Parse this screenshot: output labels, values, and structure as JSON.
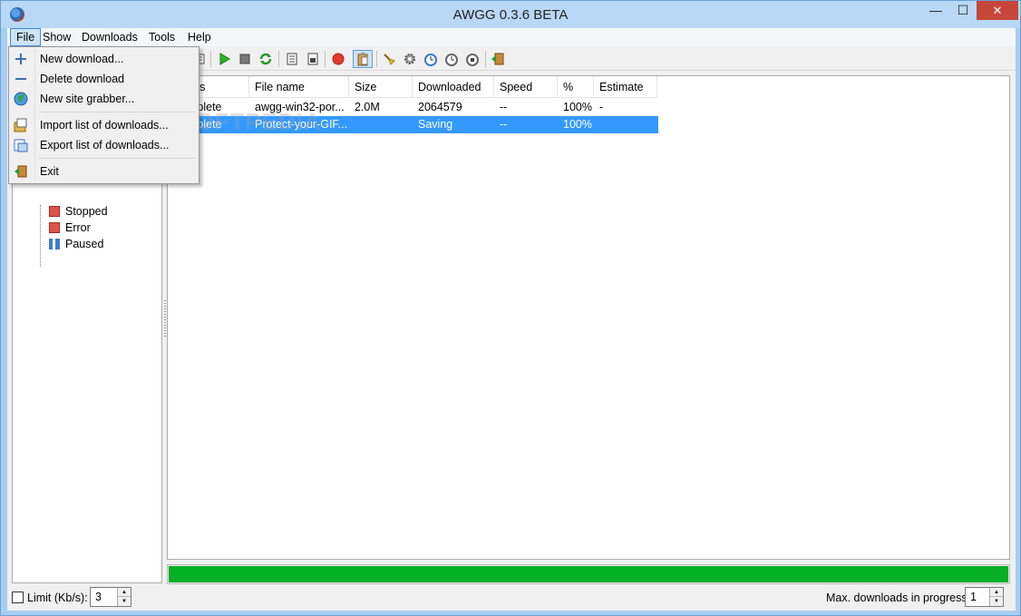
{
  "window": {
    "title": "AWGG 0.3.6 BETA",
    "minimize": "—",
    "maximize": "☐",
    "close": "✕"
  },
  "menubar": {
    "items": [
      "File",
      "Show",
      "Downloads",
      "Tools",
      "Help"
    ]
  },
  "file_menu": {
    "items": [
      {
        "label": "New download...",
        "icon": "plus-icon"
      },
      {
        "label": "Delete download",
        "icon": "minus-icon"
      },
      {
        "label": "New site grabber...",
        "icon": "globe-icon"
      },
      {
        "label": "Import list of downloads...",
        "icon": "import-icon"
      },
      {
        "label": "Export list of downloads...",
        "icon": "export-icon"
      },
      {
        "label": "Exit",
        "icon": "exit-icon"
      }
    ]
  },
  "toolbar": {
    "buttons": [
      "list-icon",
      "start-icon",
      "stop-icon",
      "restart-icon",
      "queue-icon",
      "queue-up-icon",
      "record-icon",
      "clipboard-icon",
      "clean-icon",
      "settings-icon",
      "scheduler-start-icon",
      "scheduler-clock-icon",
      "scheduler-stop-icon",
      "exit-icon"
    ]
  },
  "tree": {
    "items": [
      {
        "label": "Stopped",
        "color": "#e0524a"
      },
      {
        "label": "Error",
        "color": "#e0524a"
      },
      {
        "label": "Paused",
        "color": "#3d7bd0"
      }
    ]
  },
  "downloads": {
    "columns": [
      "Status",
      "File name",
      "Size",
      "Downloaded",
      "Speed",
      "%",
      "Estimate"
    ],
    "rows": [
      {
        "status": "Complete",
        "file_name": "awgg-win32-por...",
        "size": "2.0M",
        "downloaded": "2064579",
        "speed": "--",
        "percent": "100%",
        "estimate": "-"
      },
      {
        "status": "Complete",
        "file_name": "Protect-your-GIF...",
        "size": "",
        "downloaded": "Saving",
        "speed": "--",
        "percent": "100%",
        "estimate": ""
      }
    ]
  },
  "progress": {
    "value": 1.0,
    "color": "#06b025"
  },
  "statusbar": {
    "limit_label": "Limit (Kb/s):",
    "limit_value": "3",
    "max_label": "Max. downloads in progress:",
    "max_value": "1"
  },
  "watermark": "SOFTPEDIA"
}
